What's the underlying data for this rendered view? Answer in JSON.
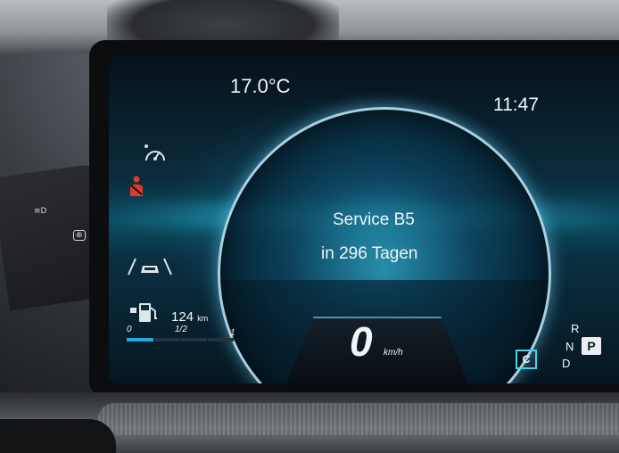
{
  "cluster": {
    "outside_temperature": "17.0°C",
    "clock": "11:47",
    "message_line1": "Service B5",
    "message_line2": "in 296 Tagen",
    "speed_value": "0",
    "speed_unit": "km/h",
    "range_value": "124",
    "range_unit": "km",
    "fuel_scale": [
      "0",
      "1/2",
      "1"
    ],
    "fuel_level_fraction": 0.25,
    "drive_mode": "C",
    "gear_options": [
      "R",
      "N",
      "P",
      "D"
    ],
    "selected_gear": "P"
  },
  "icons": {
    "speedometer_icon": "speedometer-icon",
    "seatbelt_icon": "seatbelt-warning-icon",
    "lane_assist_icon": "lane-assist-icon",
    "fuel_icon": "fuel-pump-icon"
  },
  "colors": {
    "accent": "#2aa7d6",
    "warning": "#e23a2a",
    "text": "#f2f5f8"
  }
}
